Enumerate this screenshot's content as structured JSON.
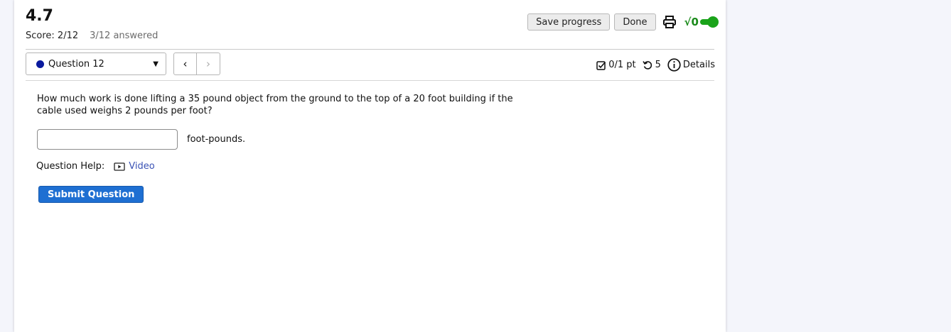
{
  "header": {
    "title": "4.7",
    "score": "Score: 2/12",
    "answered": "3/12 answered"
  },
  "actions": {
    "save_label": "Save progress",
    "done_label": "Done",
    "print_icon": "printer-icon",
    "math_symbol": "√0"
  },
  "question_nav": {
    "selected": "Question 12",
    "status_color": "#0a1a9e",
    "prev_symbol": "‹",
    "next_symbol": "›"
  },
  "meta": {
    "points": "0/1 pt",
    "attempts": "5",
    "details_label": "Details"
  },
  "question": {
    "text": "How much work is done lifting a 35 pound object from the ground to the top of a 20 foot building if the cable used weighs 2 pounds per foot?",
    "answer_value": "",
    "unit": "foot-pounds."
  },
  "help": {
    "label": "Question Help:",
    "video_label": "Video"
  },
  "submit_label": "Submit Question",
  "colors": {
    "accent_blue": "#1e6fd2",
    "toggle_green": "#1aa31a",
    "link": "#3a52b5"
  }
}
